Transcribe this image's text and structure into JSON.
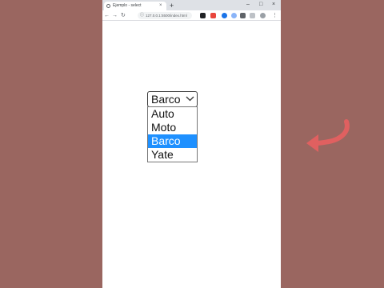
{
  "browser": {
    "tab_title": "Ejemplo - select",
    "tab_close": "×",
    "new_tab": "+",
    "window_controls": {
      "minimize": "–",
      "maximize": "□",
      "close": "×"
    },
    "nav": {
      "back": "←",
      "forward": "→",
      "reload": "↻"
    },
    "address": "127.0.0.1:5500/index.html",
    "extensions": [
      {
        "name": "shield-extension-icon",
        "color": "#202124"
      },
      {
        "name": "warning-extension-icon",
        "color": "#e8453c"
      },
      {
        "name": "globe-extension-icon",
        "color": "#1a73e8"
      },
      {
        "name": "settings-extension-icon",
        "color": "#5f6368"
      },
      {
        "name": "puzzle-extension-icon",
        "color": "#5f6368"
      },
      {
        "name": "sidepanel-extension-icon",
        "color": "#5f6368"
      },
      {
        "name": "profile-avatar-icon",
        "color": "#5f6368"
      },
      {
        "name": "menu-icon",
        "color": "#5f6368"
      }
    ]
  },
  "select": {
    "current_value": "Barco",
    "options": [
      "Auto",
      "Moto",
      "Barco",
      "Yate"
    ],
    "selected_index": 2
  },
  "annotation": {
    "arrow_color": "#e06060"
  }
}
